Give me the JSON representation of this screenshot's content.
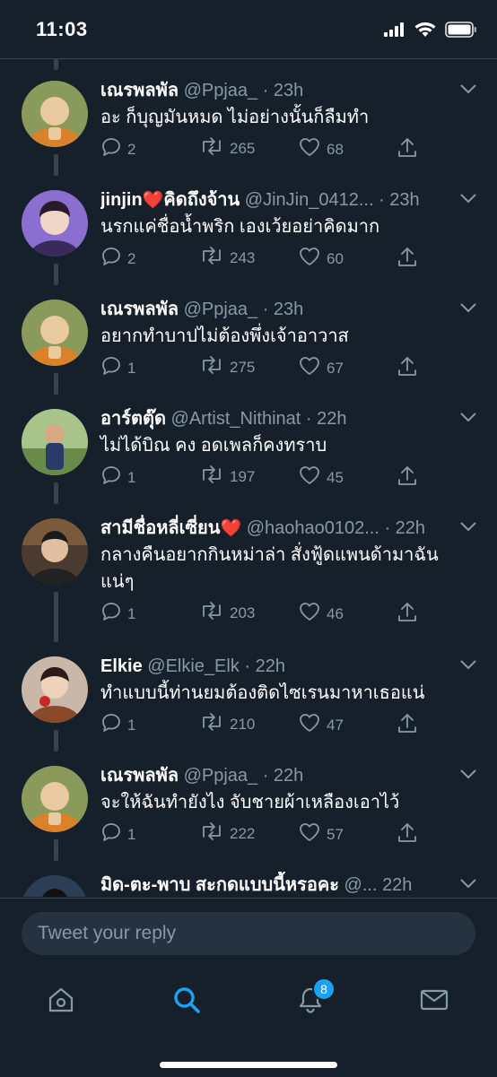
{
  "status_bar": {
    "time": "11:03"
  },
  "tweets": [
    {
      "name": "เณรพลพัล",
      "handle": "@Ppjaa_",
      "time": "· 23h",
      "text": "อะ ก็บุญมันหมด ไม่อย่างนั้นก็ลืมทำ",
      "replies": "2",
      "retweets": "265",
      "likes": "68",
      "avatar_color": "#c8782c"
    },
    {
      "name": "jinjin",
      "name_suffix": "คิดถึงจ้าน",
      "heart": "❤️",
      "handle": "@JinJin_0412...",
      "time": "· 23h",
      "text": "นรกแค่ชื่อน้ำพริก เองเว้ยอย่าคิดมาก",
      "replies": "2",
      "retweets": "243",
      "likes": "60",
      "avatar_color": "#6a4fb0"
    },
    {
      "name": "เณรพลพัล",
      "handle": "@Ppjaa_",
      "time": "· 23h",
      "text": "อยากทำบาปไม่ต้องพึ่งเจ้าอาวาส",
      "replies": "1",
      "retweets": "275",
      "likes": "67",
      "avatar_color": "#c8782c"
    },
    {
      "name": "อาร์ตตุ๊ด",
      "handle": "@Artist_Nithinat",
      "time": "· 22h",
      "text": "ไม่ได้บิณ คง อดเพลก็คงทราบ",
      "replies": "1",
      "retweets": "197",
      "likes": "45",
      "avatar_color": "#5c8a3a"
    },
    {
      "name": "สามีชื่อหลี่เซี่ยน",
      "heart": "❤️",
      "handle": "@haohao0102...",
      "time": "· 22h",
      "text": "กลางคืนอยากกินหม่าล่า สั่งฟู้ดแพนด้ามาฉันแน่ๆ",
      "replies": "1",
      "retweets": "203",
      "likes": "46",
      "avatar_color": "#5a3a2a"
    },
    {
      "name": "Elkie",
      "handle": "@Elkie_Elk",
      "time": "· 22h",
      "text": "ทำแบบนี้ท่านยมต้องติดไซเรนมาหาเธอแน่",
      "replies": "1",
      "retweets": "210",
      "likes": "47",
      "avatar_color": "#7a4a3a"
    },
    {
      "name": "เณรพลพัล",
      "handle": "@Ppjaa_",
      "time": "· 22h",
      "text": "จะให้ฉันทำยังไง จับชายผ้าเหลืองเอาไว้",
      "replies": "1",
      "retweets": "222",
      "likes": "57",
      "avatar_color": "#c8782c"
    },
    {
      "name": "มิด-ตะ-พาบ สะกดแบบนี้หรอคะ",
      "handle": "@...",
      "time": "22h",
      "text": "",
      "avatar_color": "#2c3e55"
    }
  ],
  "reply_bar": {
    "placeholder": "Tweet your reply"
  },
  "nav": {
    "notifications_badge": "8",
    "active_color": "#1da1f2"
  }
}
